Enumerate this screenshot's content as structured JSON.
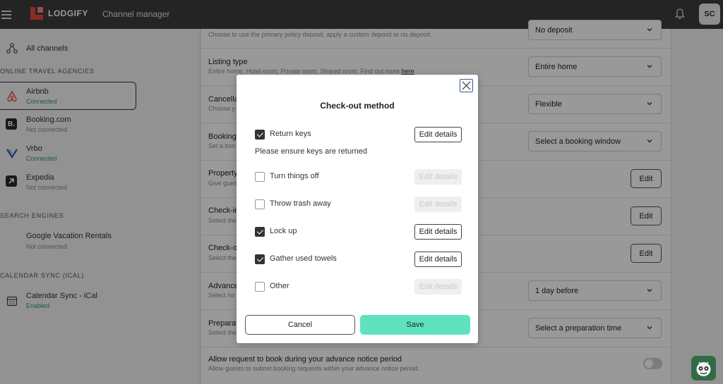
{
  "header": {
    "brand": "LODGIFY",
    "title": "Channel manager",
    "avatar_initials": "SC"
  },
  "sidebar": {
    "all_channels": "All channels",
    "sections": {
      "ota": "ONLINE TRAVEL AGENCIES",
      "search": "SEARCH ENGINES",
      "calendar": "CALENDAR SYNC (ICAL)"
    },
    "channels": [
      {
        "name": "Airbnb",
        "status": "Connected"
      },
      {
        "name": "Booking.com",
        "status": "Not connected"
      },
      {
        "name": "Vrbo",
        "status": "Connected"
      },
      {
        "name": "Expedia",
        "status": "Not connected"
      },
      {
        "name": "Google Vacation Rentals",
        "status": "Not connected"
      },
      {
        "name": "Calendar Sync - iCal",
        "status": "Enabled"
      }
    ]
  },
  "main": {
    "rows": [
      {
        "title": "",
        "desc": "Choose to use the primary policy deposit, apply a custom deposit or no deposit.",
        "control": "No deposit"
      },
      {
        "title": "Listing type",
        "desc": "Entire home, Hotel room, Private room, Shared room. Find out more",
        "link": "here",
        "control": "Entire home"
      },
      {
        "title": "Cancella",
        "desc": "Choose y",
        "control": "Flexible"
      },
      {
        "title": "Booking",
        "desc": "Set a boo",
        "control": "Select a booking window"
      },
      {
        "title": "Property",
        "desc": "Give gues",
        "control": "Edit"
      },
      {
        "title": "Check-in",
        "desc": "Select the",
        "control": "Edit"
      },
      {
        "title": "Check-o",
        "desc": "Select the",
        "control": "Edit"
      },
      {
        "title": "Advance",
        "desc": "Select ho",
        "control": "1 day before"
      },
      {
        "title": "Preparat",
        "desc": "Select the",
        "control": "Select a preparation time"
      },
      {
        "title": "Allow request to book during your advance notice period",
        "desc": "Allow guests to submit booking requests within your advance notice period.",
        "control": ""
      }
    ]
  },
  "modal": {
    "title": "Check-out method",
    "note": "Please ensure keys are returned",
    "edit_label": "Edit details",
    "options": [
      {
        "label": "Return keys",
        "checked": true
      },
      {
        "label": "Turn things off",
        "checked": false
      },
      {
        "label": "Throw trash away",
        "checked": false
      },
      {
        "label": "Lock up",
        "checked": true
      },
      {
        "label": "Gather used towels",
        "checked": true
      },
      {
        "label": "Other",
        "checked": false
      }
    ],
    "cancel_label": "Cancel",
    "save_label": "Save"
  },
  "colors": {
    "topbar": "#3d3d3d",
    "brand_red": "#e8493f",
    "save_button": "#5ee3bf",
    "connected_green": "#2e9a5e"
  }
}
